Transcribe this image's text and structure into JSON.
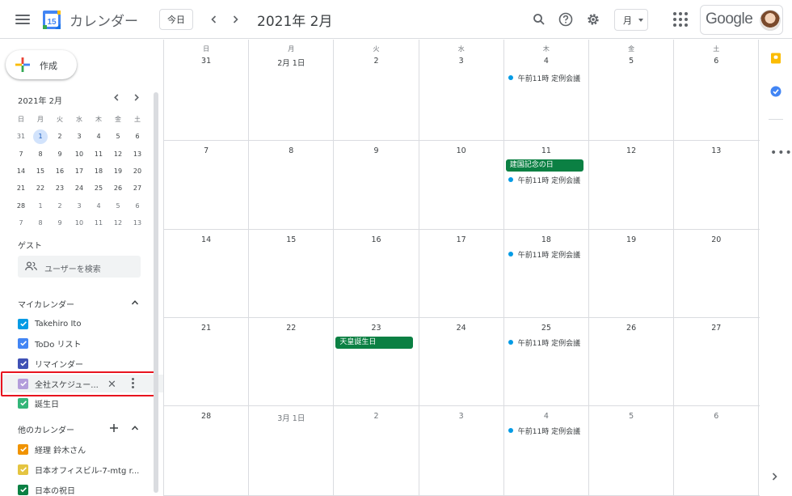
{
  "header": {
    "app_title": "カレンダー",
    "logo_day": "15",
    "today_label": "今日",
    "month_title": "2021年 2月",
    "view_label": "月",
    "google_label": "Google"
  },
  "sidebar": {
    "create_label": "作成",
    "mini_title": "2021年 2月",
    "mini_weekdays": [
      "日",
      "月",
      "火",
      "水",
      "木",
      "金",
      "土"
    ],
    "mini_weeks": [
      [
        "31",
        "1",
        "2",
        "3",
        "4",
        "5",
        "6"
      ],
      [
        "7",
        "8",
        "9",
        "10",
        "11",
        "12",
        "13"
      ],
      [
        "14",
        "15",
        "16",
        "17",
        "18",
        "19",
        "20"
      ],
      [
        "21",
        "22",
        "23",
        "24",
        "25",
        "26",
        "27"
      ],
      [
        "28",
        "1",
        "2",
        "3",
        "4",
        "5",
        "6"
      ],
      [
        "7",
        "8",
        "9",
        "10",
        "11",
        "12",
        "13"
      ]
    ],
    "guest_label": "ゲスト",
    "guest_placeholder": "ユーザーを検索",
    "my_calendars_label": "マイカレンダー",
    "my_calendars": [
      {
        "name": "Takehiro Ito",
        "color": "#039be5"
      },
      {
        "name": "ToDo リスト",
        "color": "#4285f4"
      },
      {
        "name": "リマインダー",
        "color": "#3f51b5"
      },
      {
        "name": "全社スケジュー...",
        "color": "#b39ddb"
      },
      {
        "name": "誕生日",
        "color": "#33b679"
      }
    ],
    "other_calendars_label": "他のカレンダー",
    "other_calendars": [
      {
        "name": "経理 鈴木さん",
        "color": "#f09300"
      },
      {
        "name": "日本オフィスビル-7-mtg r...",
        "color": "#e4c441"
      },
      {
        "name": "日本の祝日",
        "color": "#0b8043"
      }
    ]
  },
  "calendar": {
    "weekdays": [
      "日",
      "月",
      "火",
      "水",
      "木",
      "金",
      "土"
    ],
    "weeks": [
      [
        {
          "label": "31"
        },
        {
          "label": "2月 1日"
        },
        {
          "label": "2"
        },
        {
          "label": "3"
        },
        {
          "label": "4",
          "event": "午前11時 定例会議"
        },
        {
          "label": "5"
        },
        {
          "label": "6"
        }
      ],
      [
        {
          "label": "7"
        },
        {
          "label": "8"
        },
        {
          "label": "9"
        },
        {
          "label": "10"
        },
        {
          "label": "11",
          "holiday": "建国記念の日",
          "event": "午前11時 定例会議"
        },
        {
          "label": "12"
        },
        {
          "label": "13"
        }
      ],
      [
        {
          "label": "14"
        },
        {
          "label": "15"
        },
        {
          "label": "16"
        },
        {
          "label": "17"
        },
        {
          "label": "18",
          "event": "午前11時 定例会議"
        },
        {
          "label": "19"
        },
        {
          "label": "20"
        }
      ],
      [
        {
          "label": "21"
        },
        {
          "label": "22"
        },
        {
          "label": "23",
          "holiday": "天皇誕生日"
        },
        {
          "label": "24"
        },
        {
          "label": "25",
          "event": "午前11時 定例会議"
        },
        {
          "label": "26"
        },
        {
          "label": "27"
        }
      ],
      [
        {
          "label": "28"
        },
        {
          "label": "3月 1日",
          "dim": true
        },
        {
          "label": "2",
          "dim": true
        },
        {
          "label": "3",
          "dim": true
        },
        {
          "label": "4",
          "dim": true,
          "event": "午前11時 定例会議"
        },
        {
          "label": "5",
          "dim": true
        },
        {
          "label": "6",
          "dim": true
        }
      ]
    ]
  },
  "colors": {
    "holiday": "#0b8043",
    "event_dot": "#039be5",
    "highlight_border": "#e8141f"
  }
}
